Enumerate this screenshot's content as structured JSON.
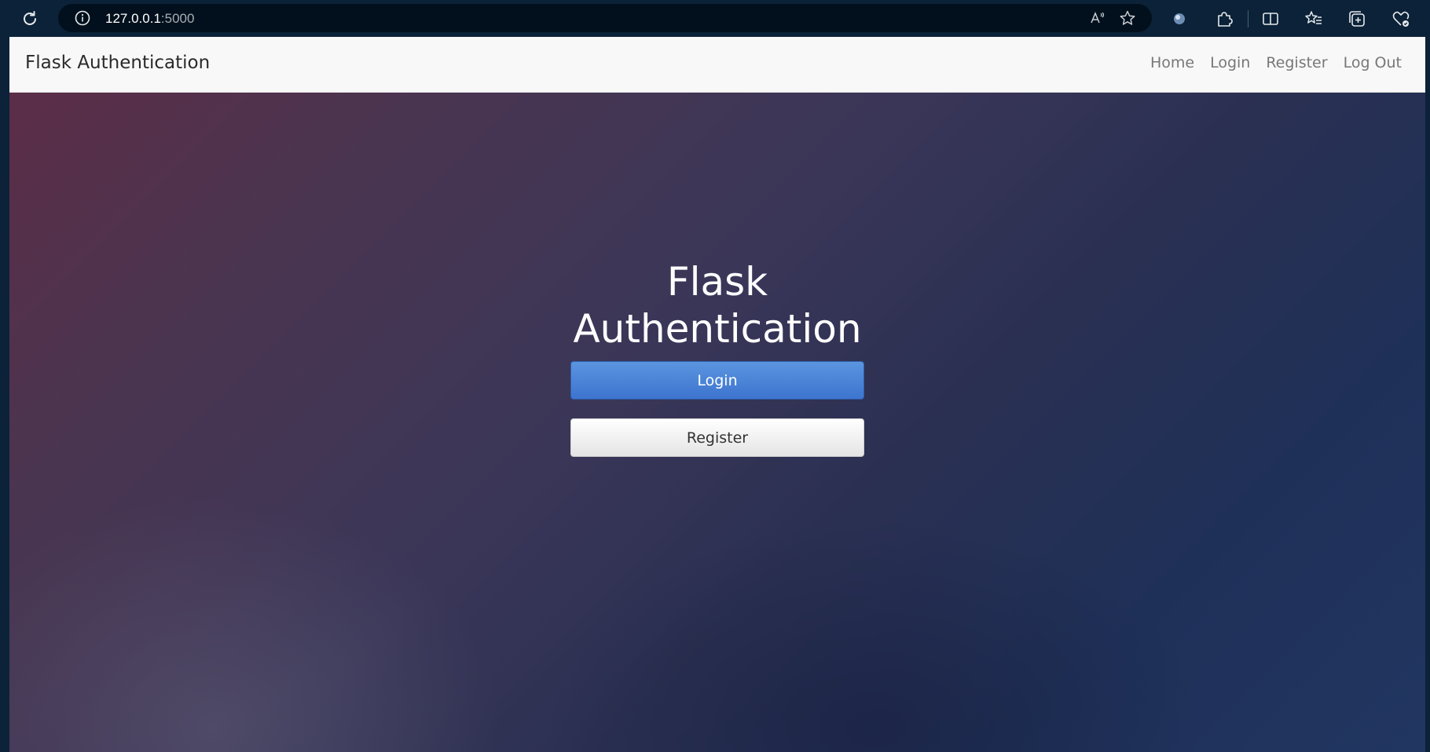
{
  "browser": {
    "url_host": "127.0.0.1",
    "url_port": ":5000"
  },
  "navbar": {
    "brand": "Flask Authentication",
    "links": [
      "Home",
      "Login",
      "Register",
      "Log Out"
    ]
  },
  "hero": {
    "title_line1": "Flask",
    "title_line2": "Authentication",
    "login_button": "Login",
    "register_button": "Register"
  },
  "colors": {
    "browser_chrome": "#0b2238",
    "address_bar": "#02101d",
    "navbar_bg": "#f8f8f8",
    "login_button": "#4a83d8",
    "register_button": "#f2f2f2"
  }
}
